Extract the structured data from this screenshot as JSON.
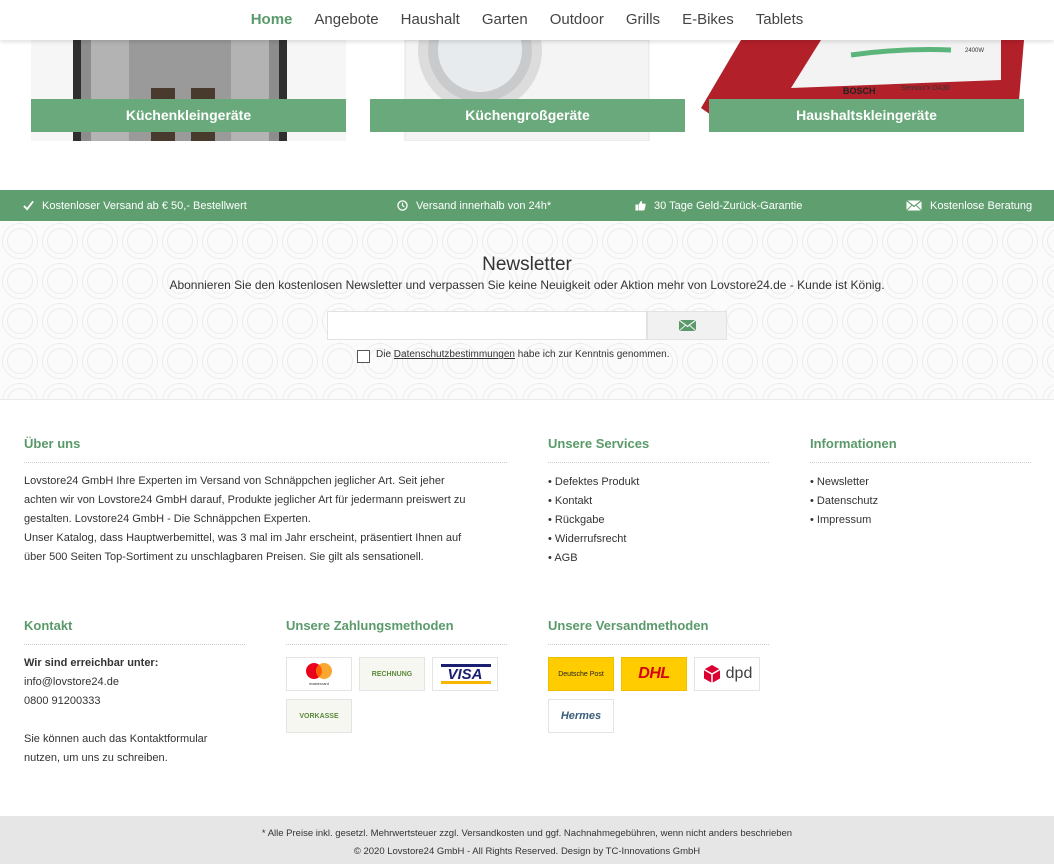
{
  "nav": {
    "items": [
      "Home",
      "Angebote",
      "Haushalt",
      "Garten",
      "Outdoor",
      "Grills",
      "E-Bikes",
      "Tablets"
    ]
  },
  "categories": [
    {
      "label": "Küchenkleingeräte",
      "icon": "coffee-machine-image"
    },
    {
      "label": "Küchengroßgeräte",
      "icon": "washing-machine-image"
    },
    {
      "label": "Haushaltskleingeräte",
      "icon": "iron-image",
      "brand_text": "BOSCH",
      "model_text": "Sensixx'x DA30",
      "watt_text": "2400W"
    }
  ],
  "benefits": [
    {
      "icon": "check-icon",
      "text": "Kostenloser Versand ab € 50,- Bestellwert"
    },
    {
      "icon": "clock-icon",
      "text": "Versand innerhalb von 24h*"
    },
    {
      "icon": "thumbs-up-icon",
      "text": "30 Tage Geld-Zurück-Garantie"
    },
    {
      "icon": "envelope-icon",
      "text": "Kostenlose Beratung"
    }
  ],
  "newsletter": {
    "title": "Newsletter",
    "subtitle": "Abonnieren Sie den kostenlosen Newsletter und verpassen Sie keine Neuigkeit oder Aktion mehr von Lovstore24.de - Kunde ist König.",
    "input_value": "",
    "submit_icon": "envelope-icon",
    "consent_before": "Die",
    "consent_link": "Datenschutzbestimmungen",
    "consent_after": "habe ich zur Kenntnis genommen."
  },
  "footer": {
    "about": {
      "heading": "Über uns",
      "text1": "Lovstore24 GmbH Ihre Experten im Versand von Schnäppchen jeglicher Art. Seit jeher",
      "text2": "achten wir von Lovstore24 GmbH darauf, Produkte jeglicher Art für jedermann preiswert zu",
      "text3": "gestalten. Lovstore24 GmbH - Die Schnäppchen Experten.",
      "text4": "Unser Katalog, dass Hauptwerbemittel, was 3 mal im Jahr erscheint, präsentiert Ihnen auf",
      "text5": "über 500 Seiten Top-Sortiment zu unschlagbaren Preisen. Sie gilt als sensationell."
    },
    "services": {
      "heading": "Unsere Services",
      "items": [
        "Defektes Produkt",
        "Kontakt",
        "Rückgabe",
        "Widerrufsrecht",
        "AGB"
      ]
    },
    "info": {
      "heading": "Informationen",
      "items": [
        "Newsletter",
        "Datenschutz",
        "Impressum"
      ]
    },
    "contact": {
      "heading": "Kontakt",
      "reach": "Wir sind erreichbar unter:",
      "email": "info@lovstore24.de",
      "phone": "0800 91200333",
      "form1": "Sie können auch das Kontaktformular",
      "form2": "nutzen, um uns zu schreiben."
    },
    "payment": {
      "heading": "Unsere Zahlungsmethoden",
      "methods": [
        {
          "name": "mastercard",
          "label": "mastercard"
        },
        {
          "name": "rechnung",
          "label": "RECHNUNG"
        },
        {
          "name": "visa",
          "label": "VISA"
        },
        {
          "name": "vorkasse",
          "label": "VORKASSE"
        }
      ]
    },
    "shipping": {
      "heading": "Unsere Versandmethoden",
      "methods": [
        {
          "name": "deutsche-post",
          "label": "Deutsche Post"
        },
        {
          "name": "dhl",
          "label": "DHL"
        },
        {
          "name": "dpd",
          "label": "dpd"
        },
        {
          "name": "hermes",
          "label": "Hermes"
        }
      ]
    }
  },
  "bottom": {
    "line1": "* Alle Preise inkl. gesetzl. Mehrwertsteuer zzgl. Versandkosten und ggf. Nachnahmegebühren, wenn nicht anders beschrieben",
    "line2": "© 2020 Lovstore24 GmbH - All Rights Reserved. Design by TC-Innovations GmbH"
  },
  "colors": {
    "accent": "#5f9f6f",
    "label_green": "#6aa97b",
    "dhl_yellow": "#ffcc00",
    "dhl_red": "#d40511",
    "dpd_red": "#dc0032",
    "visa_blue": "#1a1f71"
  }
}
